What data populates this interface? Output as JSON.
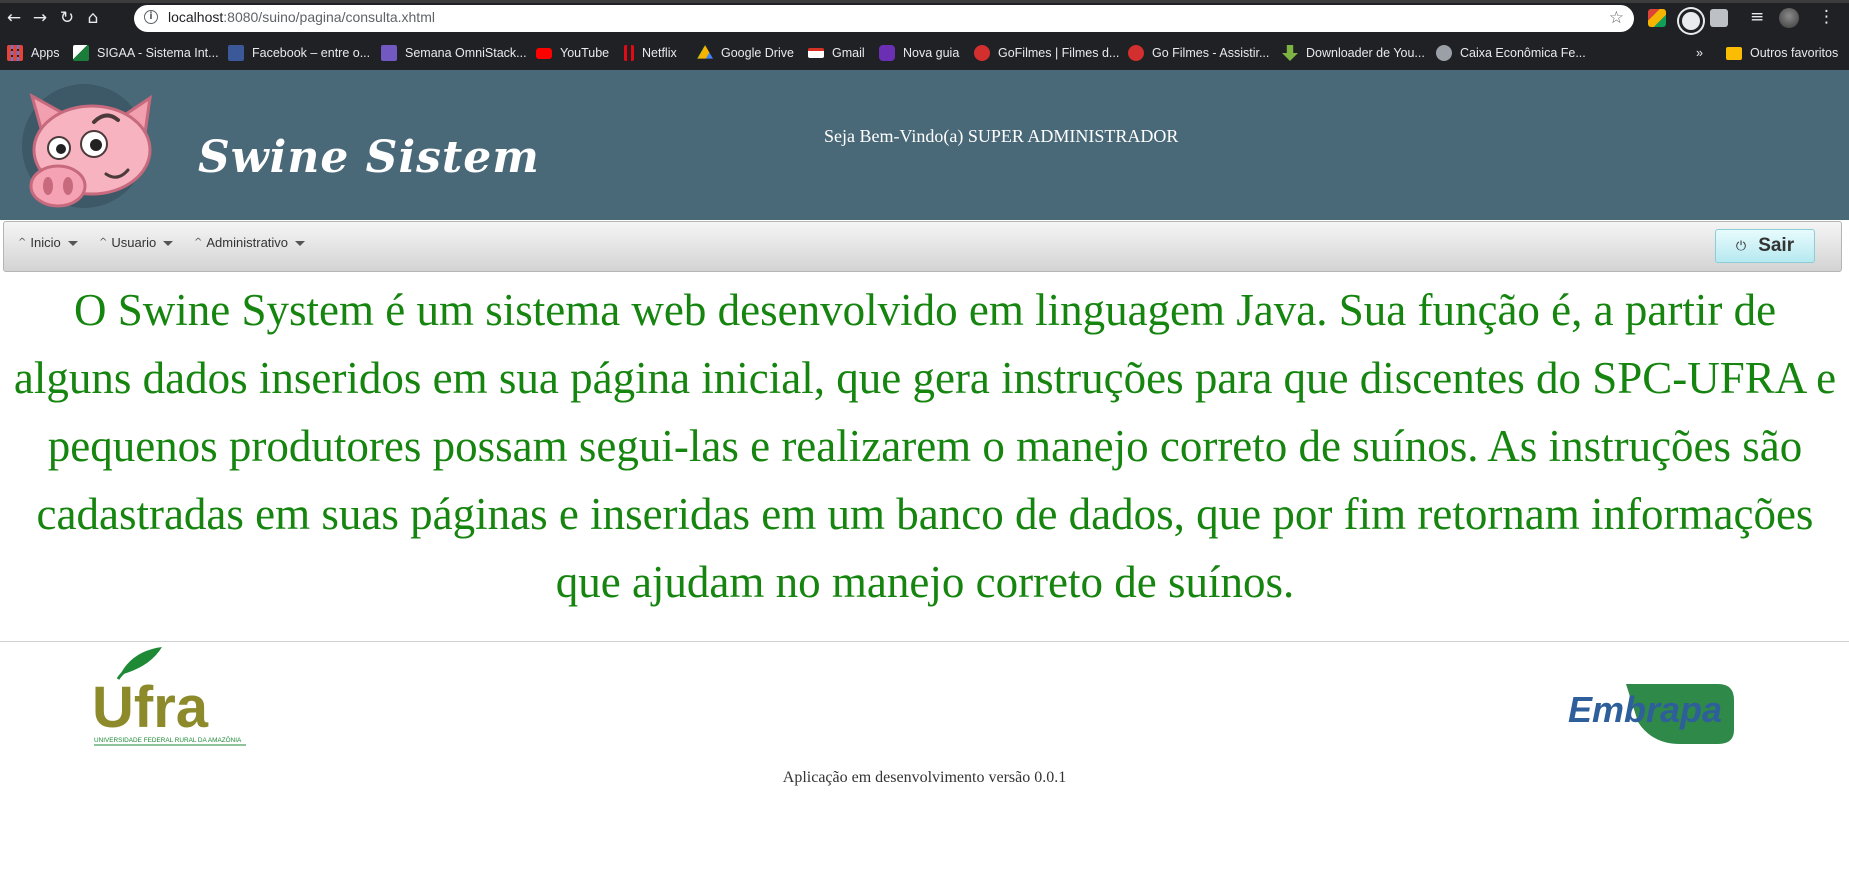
{
  "browser": {
    "url_host": "localhost",
    "url_path": ":8080/suino/pagina/consulta.xhtml",
    "bookmarks": [
      {
        "label": "Apps",
        "icon": "apps-grid-icon"
      },
      {
        "label": "SIGAA - Sistema Int...",
        "icon": "sigaa-icon"
      },
      {
        "label": "Facebook – entre o...",
        "icon": "facebook-icon"
      },
      {
        "label": "Semana OmniStack...",
        "icon": "rocketseat-icon"
      },
      {
        "label": "YouTube",
        "icon": "youtube-icon"
      },
      {
        "label": "Netflix",
        "icon": "netflix-icon"
      },
      {
        "label": "Google Drive",
        "icon": "google-drive-icon"
      },
      {
        "label": "Gmail",
        "icon": "gmail-icon"
      },
      {
        "label": "Nova guia",
        "icon": "nova-guia-icon"
      },
      {
        "label": "GoFilmes | Filmes d...",
        "icon": "gofilmes-icon"
      },
      {
        "label": "Go Filmes - Assistir...",
        "icon": "gofilmes-icon"
      },
      {
        "label": "Downloader de You...",
        "icon": "download-arrow-icon"
      },
      {
        "label": "Caixa Econômica Fe...",
        "icon": "globe-icon"
      }
    ],
    "more_bookmarks": "»",
    "other_bookmarks": "Outros favoritos"
  },
  "header": {
    "brand": "Swine Sistem",
    "welcome": "Seja Bem-Vindo(a) SUPER ADMINISTRADOR"
  },
  "menu": {
    "items": [
      {
        "label": "Inicio"
      },
      {
        "label": "Usuario"
      },
      {
        "label": "Administrativo"
      }
    ],
    "logout_label": "Sair"
  },
  "main": {
    "intro": "O Swine System é um sistema web desenvolvido em linguagem Java. Sua função é, a partir de alguns dados inseridos em sua página inicial, que gera instruções para que discentes do SPC-UFRA e pequenos produtores possam segui-las e realizarem o manejo correto de suínos. As instruções são cadastradas em suas páginas e inseridas em um banco de dados, que por fim retornam informações que ajudam no manejo correto de suínos."
  },
  "footer": {
    "ufra_logo_text": "Ufra",
    "ufra_logo_subtitle": "UNIVERSIDADE FEDERAL RURAL DA AMAZÔNIA",
    "embrapa_logo_text": "Embrapa",
    "version_text": "Aplicação em desenvolvimento versão 0.0.1"
  },
  "colors": {
    "header_bg": "#4a6978",
    "intro_text": "#16850f",
    "ufra_green": "#1e8a36",
    "ufra_olive": "#8c8a2a",
    "embrapa_blue": "#2e5f9a",
    "embrapa_green": "#2f8a4a"
  }
}
